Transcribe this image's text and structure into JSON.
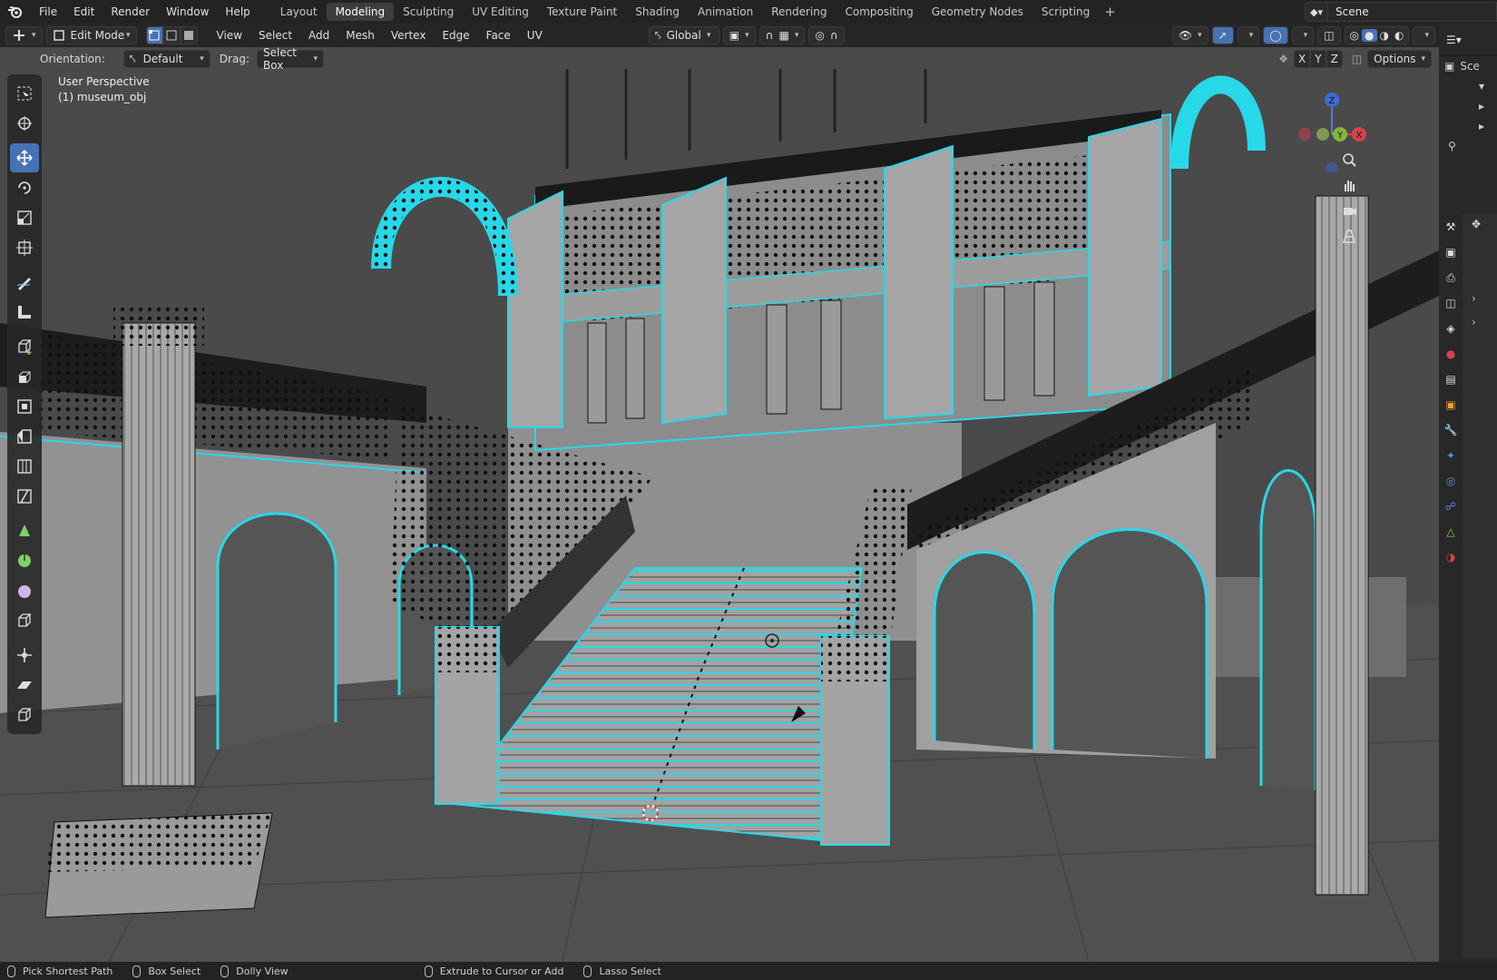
{
  "topbar": {
    "menus": [
      "File",
      "Edit",
      "Render",
      "Window",
      "Help"
    ],
    "workspaces": [
      "Layout",
      "Modeling",
      "Sculpting",
      "UV Editing",
      "Texture Paint",
      "Shading",
      "Animation",
      "Rendering",
      "Compositing",
      "Geometry Nodes",
      "Scripting"
    ],
    "active_workspace": "Modeling",
    "scene_name": "Scene"
  },
  "header": {
    "mode": "Edit Mode",
    "menus": [
      "View",
      "Select",
      "Add",
      "Mesh",
      "Vertex",
      "Edge",
      "Face",
      "UV"
    ],
    "transform_orientation": "Global",
    "options_label": "Options",
    "axes": [
      "X",
      "Y",
      "Z"
    ]
  },
  "tool_settings": {
    "orientation_label": "Orientation:",
    "orientation_value": "Default",
    "drag_label": "Drag:",
    "drag_value": "Select Box"
  },
  "viewport": {
    "view_name": "User Perspective",
    "object_name": "(1) museum_obj",
    "gizmo_axes": {
      "z": "Z",
      "y": "Y",
      "x": "X"
    },
    "colors": {
      "selected_edge": "#27d8e8",
      "mesh_face": "#9a9a9a",
      "background": "#4a4a4a",
      "active_tool": "#4772b3"
    }
  },
  "statusbar": {
    "items": [
      "Pick Shortest Path",
      "Box Select",
      "Dolly View",
      "Extrude to Cursor or Add",
      "Lasso Select"
    ]
  },
  "outliner": {
    "row1": "Sce"
  }
}
